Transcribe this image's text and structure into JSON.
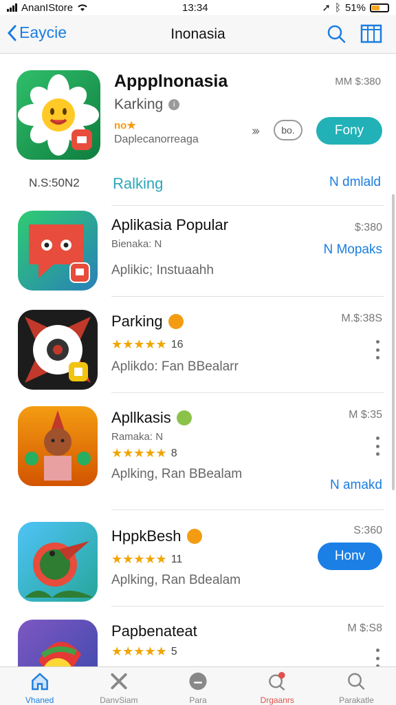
{
  "status_bar": {
    "carrier": "AnanIStore",
    "time": "13:34",
    "battery": "51%",
    "battery_level": 0.51
  },
  "nav": {
    "back_label": "Eaycie",
    "title": "Inonasia"
  },
  "featured": {
    "name": "Appplnonasia",
    "subtitle": "Karking",
    "rating_text": "no★",
    "description": "Daplecanorreaga",
    "price": "MM $:380",
    "arrows": "›››",
    "pill_label": "bo.",
    "get_label": "Fony",
    "footer_left": "N.S:50N2",
    "footer_mid": "Ralking",
    "footer_right": "N dmlald"
  },
  "rows": [
    {
      "name": "Aplikasia Popular",
      "meta": "Bienaka: N",
      "description": "Aplikic; Instuaahh",
      "price": "$:380",
      "link": "N Mopaks"
    },
    {
      "name": "Parking",
      "stars": "★★★★★",
      "rating": 4.5,
      "count": "16",
      "description": "Aplikdo: Fan BBealarr",
      "price": "M.$:38S"
    },
    {
      "name": "Apllkasis",
      "meta": "Ramaka: N",
      "stars": "★★★★★",
      "rating": 4.5,
      "count": "8",
      "description": "Aplking, Ran BBealam",
      "price": "M $:35",
      "link": "N amakd"
    },
    {
      "name": "HppkBesh",
      "stars": "★★★★★",
      "rating": 4.5,
      "count": "11",
      "description": "Aplking, Ran Bdealam",
      "price": "S:360",
      "get_label": "Honv"
    },
    {
      "name": "Papbenateat",
      "stars": "★★★★★",
      "rating": 4.5,
      "count": "5",
      "price": "M $:S8"
    }
  ],
  "tabs": [
    {
      "label": "Vhaned",
      "icon": "home-icon",
      "state": "active"
    },
    {
      "label": "DanvSiam",
      "icon": "close-x-icon",
      "state": ""
    },
    {
      "label": "Para",
      "icon": "chat-icon",
      "state": ""
    },
    {
      "label": "Drgaanrs",
      "icon": "search-alert-icon",
      "state": "alert"
    },
    {
      "label": "Parakatle",
      "icon": "search-icon",
      "state": ""
    }
  ],
  "colors": {
    "accent": "#1a7de0",
    "teal": "#21b1b7",
    "star": "#f0a500"
  }
}
